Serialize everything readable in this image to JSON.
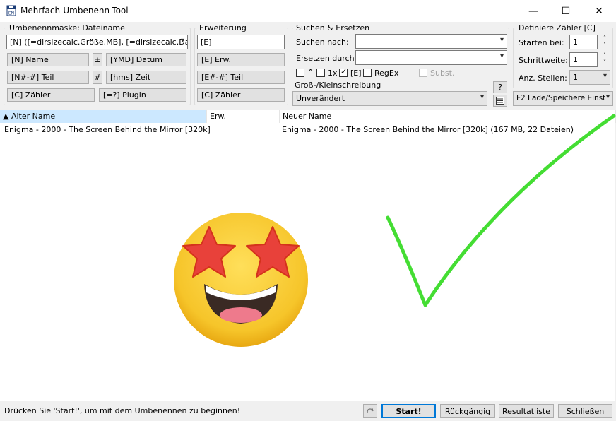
{
  "window": {
    "title": "Mehrfach-Umbenenn-Tool",
    "app_icon_text": "EN",
    "minimize": "—",
    "maximize": "☐",
    "close": "✕"
  },
  "mask": {
    "legend": "Umbenennmaske: Dateiname",
    "value": "[N] ([=dirsizecalc.Größe.MB], [=dirsizecalc.Dateian",
    "buttons": {
      "name": "[N]  Name",
      "plusminus": "±",
      "datum": "[YMD]  Datum",
      "teil": "[N#-#] Teil",
      "hash": "#",
      "zeit": "[hms]  Zeit",
      "zaehler": "[C]  Zähler",
      "plugin": "[=?]  Plugin"
    }
  },
  "extension": {
    "legend": "Erweiterung",
    "value": "[E]",
    "buttons": {
      "erw": "[E]  Erw.",
      "teil": "[E#-#] Teil",
      "zaehler": "[C]  Zähler"
    }
  },
  "search": {
    "legend": "Suchen & Ersetzen",
    "search_label": "Suchen nach:",
    "replace_label": "Ersetzen durch:",
    "search_value": "",
    "replace_value": "",
    "opt_caret": "^",
    "opt_1x": "1x",
    "opt_e": "[E]",
    "opt_regex": "RegEx",
    "opt_subst": "Subst."
  },
  "case": {
    "legend": "Groß-/Kleinschreibung",
    "value": "Unverändert",
    "help": "?"
  },
  "counter": {
    "legend": "Definiere Zähler [C]",
    "start_label": "Starten bei:",
    "start_value": "1",
    "step_label": "Schrittweite:",
    "step_value": "1",
    "digits_label": "Anz. Stellen:",
    "digits_value": "1",
    "load_save": "F2 Lade/Speichere Einst"
  },
  "list": {
    "columns": [
      "Alter Name",
      "Erw.",
      "Neuer Name"
    ],
    "rows": [
      {
        "old": "Enigma - 2000 - The Screen Behind the Mirror  [320k]",
        "ext": "",
        "new": "Enigma - 2000 - The Screen Behind the Mirror  [320k] (167 MB, 22 Dateien)"
      }
    ]
  },
  "status": {
    "text": "Drücken Sie 'Start!', um mit dem Umbenennen zu beginnen!",
    "start": "Start!",
    "undo": "Rückgängig",
    "results": "Resultatliste",
    "close": "Schließen"
  },
  "colors": {
    "selected_header": "#cce8ff",
    "check_stroke": "#44dd33",
    "primary_border": "#0078d7"
  }
}
